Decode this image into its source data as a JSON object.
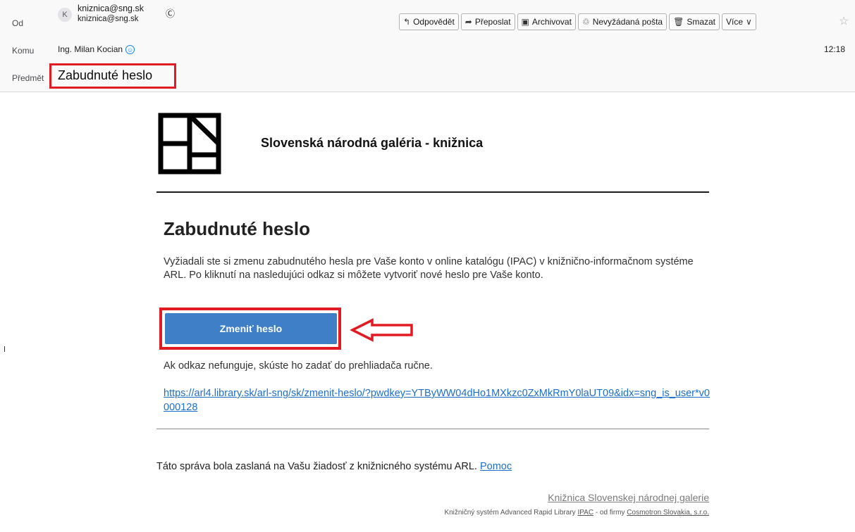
{
  "header": {
    "from_label": "Od",
    "from_avatar": "K",
    "from_name": "kniznica@sng.sk",
    "from_address": "kniznica@sng.sk",
    "from_badge_icon": "contact-badge-icon",
    "to_label": "Komu",
    "to_name": "Ing. Milan Kocian",
    "to_icon": "contact-icon",
    "time": "12:18",
    "subject_label": "Předmět",
    "subject": "Zabudnuté heslo",
    "highlight_color": "#e21b23"
  },
  "toolbar": {
    "reply": "Odpovědět",
    "forward": "Přeposlat",
    "archive": "Archivovat",
    "junk": "Nevyžádaná pošta",
    "delete": "Smazat",
    "more": "Více",
    "star_icon": "star-icon"
  },
  "email": {
    "library_name": "Slovenská národná galéria - knižnica",
    "heading": "Zabudnuté heslo",
    "paragraph": "Vyžiadali ste si zmenu zabudnutého hesla pre Vaše konto v online katalógu (IPAC) v knižnično-informačnom systéme ARL. Po kliknutí na nasledujúci odkaz si môžete vytvoriť nové heslo pre Vaše konto.",
    "button_label": "Zmeniť heslo",
    "button_color": "#3f7fc8",
    "hint": "Ak odkaz nefunguje, skúste ho zadať do prehliadača ručne.",
    "reset_link": "https://arl4.library.sk/arl-sng/sk/zmenit-heslo/?pwdkey=YTByWW04dHo1MXkzc0ZxMkRmY0laUT09&idx=sng_is_user*v0000128",
    "footer_text": "Táto správa bola zaslaná na Vašu žiadosť z knižnicného systému ARL.",
    "help_link": "Pomoc",
    "library_link": "Knižnica Slovenskej národnej galerie",
    "credits_prefix": "Knižničný systém Advanced Rapid Library",
    "credits_ipac": "IPAC",
    "credits_mid": "- od firmy",
    "credits_company": "Cosmotron Slovakia, s.r.o."
  }
}
